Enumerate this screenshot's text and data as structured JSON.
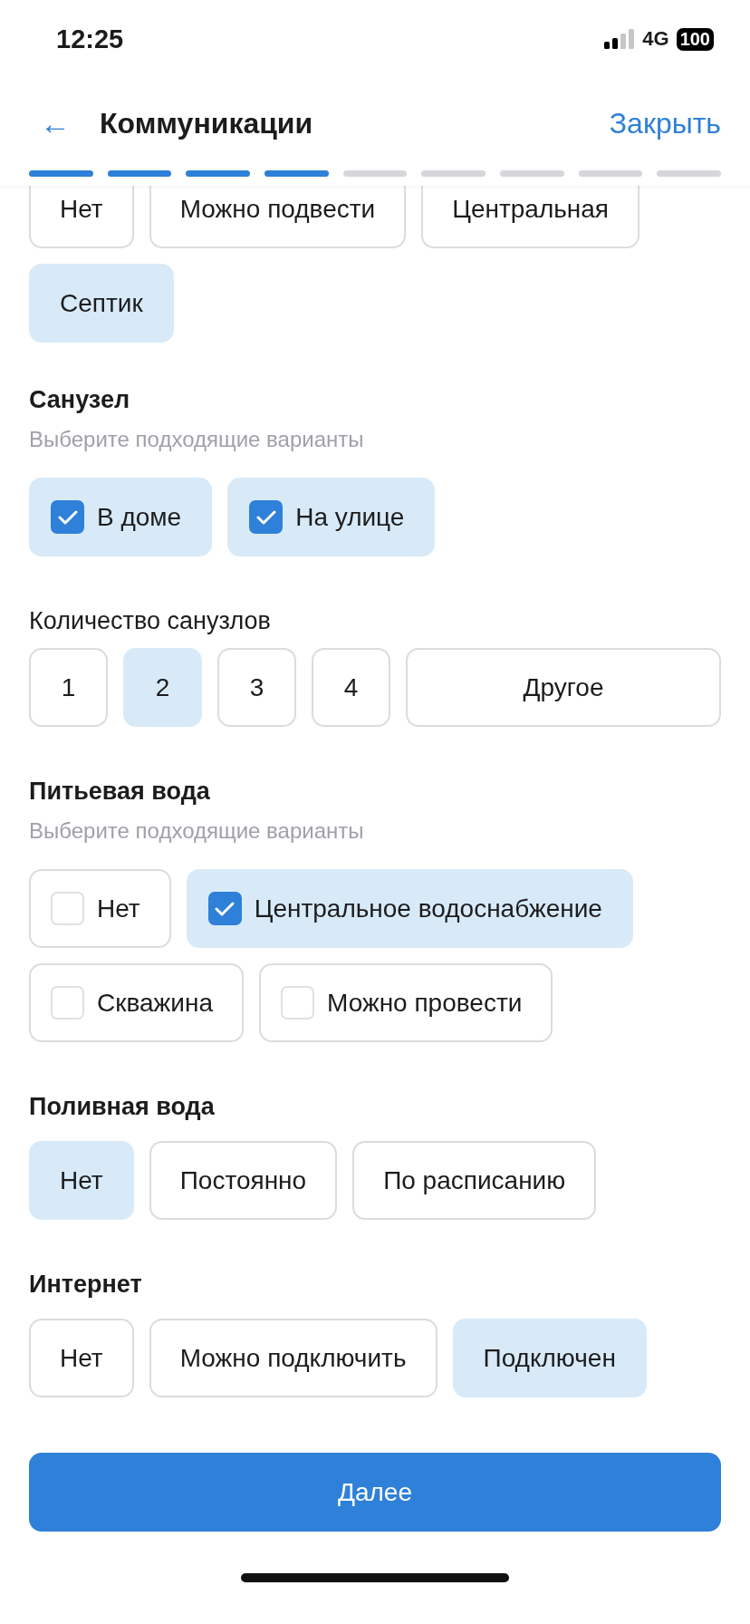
{
  "status_bar": {
    "time": "12:25",
    "network": "4G",
    "battery": "100"
  },
  "header": {
    "back": "←",
    "title": "Коммуникации",
    "close": "Закрыть"
  },
  "progress": [
    {
      "completed": true
    },
    {
      "completed": true
    },
    {
      "completed": true
    },
    {
      "completed": true
    },
    {
      "completed": false
    },
    {
      "completed": false
    },
    {
      "completed": false
    },
    {
      "completed": false
    },
    {
      "completed": false
    }
  ],
  "sections": [
    {
      "kind": "chips",
      "options": [
        {
          "label": "Нет",
          "selected": false
        },
        {
          "label": "Можно подвести",
          "selected": false
        },
        {
          "label": "Центральная",
          "selected": false
        },
        {
          "label": "Септик",
          "selected": true
        }
      ]
    },
    {
      "kind": "checks",
      "title": "Санузел",
      "hint": "Выберите подходящие варианты",
      "options": [
        {
          "label": "В доме",
          "checked": true
        },
        {
          "label": "На улице",
          "checked": true
        }
      ]
    },
    {
      "kind": "numbers",
      "label": "Количество санузлов",
      "options": [
        {
          "label": "1",
          "selected": false
        },
        {
          "label": "2",
          "selected": true
        },
        {
          "label": "3",
          "selected": false
        },
        {
          "label": "4",
          "selected": false
        },
        {
          "label": "Другое",
          "selected": false
        }
      ]
    },
    {
      "kind": "checks",
      "title": "Питьевая вода",
      "hint": "Выберите подходящие варианты",
      "options": [
        {
          "label": "Нет",
          "checked": false
        },
        {
          "label": "Центральное водоснабжение",
          "checked": true
        },
        {
          "label": "Скважина",
          "checked": false
        },
        {
          "label": "Можно провести",
          "checked": false
        }
      ]
    },
    {
      "kind": "chips",
      "title": "Поливная вода",
      "options": [
        {
          "label": "Нет",
          "selected": true
        },
        {
          "label": "Постоянно",
          "selected": false
        },
        {
          "label": "По расписанию",
          "selected": false
        }
      ]
    },
    {
      "kind": "chips",
      "title": "Интернет",
      "options": [
        {
          "label": "Нет",
          "selected": false
        },
        {
          "label": "Можно подключить",
          "selected": false
        },
        {
          "label": "Подключен",
          "selected": true
        }
      ]
    }
  ],
  "next_button": "Далее"
}
